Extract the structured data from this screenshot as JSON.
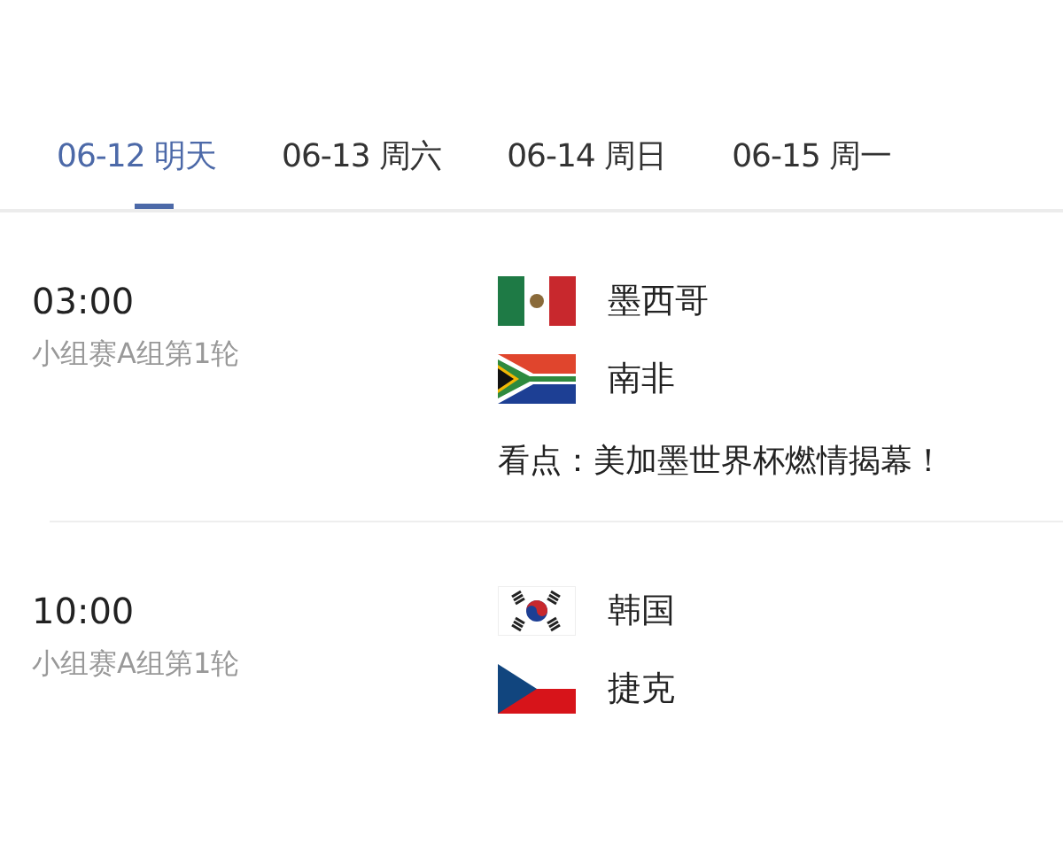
{
  "tabs": [
    {
      "date": "06-12",
      "day": "明天",
      "selected": true
    },
    {
      "date": "06-13",
      "day": "周六",
      "selected": false
    },
    {
      "date": "06-14",
      "day": "周日",
      "selected": false
    },
    {
      "date": "06-15",
      "day": "周一",
      "selected": false
    }
  ],
  "matches": [
    {
      "time": "03:00",
      "stage": "小组赛A组第1轮",
      "teams": [
        "墨西哥",
        "南非"
      ],
      "highlight_label": "看点：",
      "highlight": "美加墨世界杯燃情揭幕！"
    },
    {
      "time": "10:00",
      "stage": "小组赛A组第1轮",
      "teams": [
        "韩国",
        "捷克"
      ]
    }
  ]
}
